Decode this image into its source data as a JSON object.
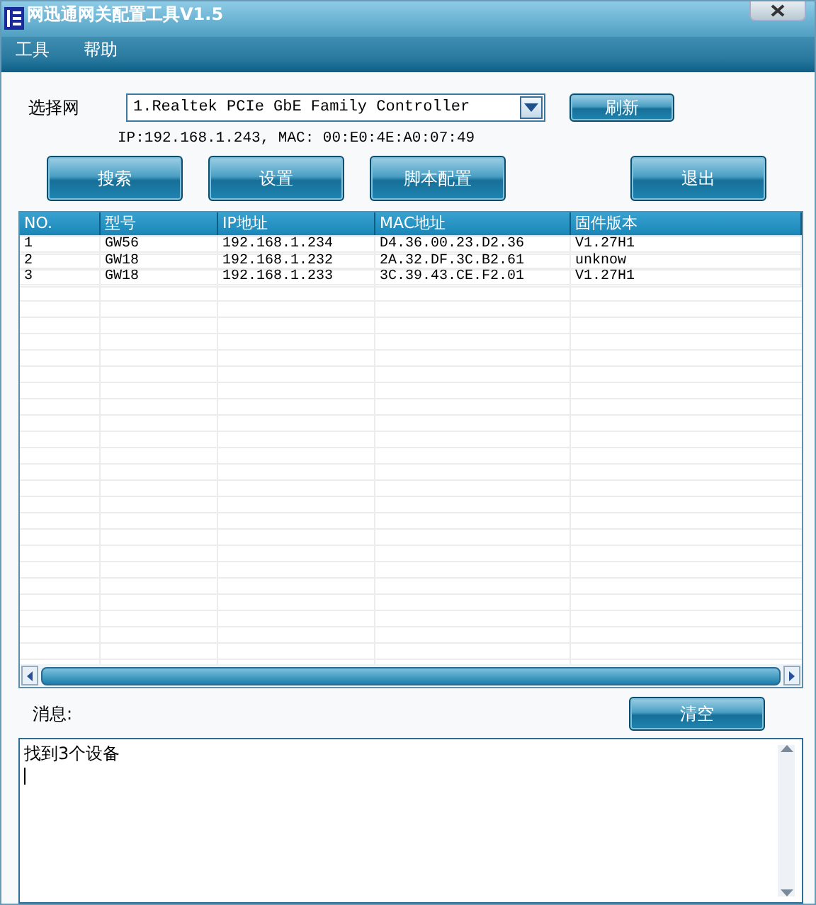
{
  "window": {
    "title": "网迅通网关配置工具V1.5"
  },
  "menu": [
    "工具",
    "帮助"
  ],
  "network": {
    "label": "选择网",
    "value": "1.Realtek PCIe GbE Family Controller",
    "refresh": "刷新",
    "info": "IP:192.168.1.243, MAC: 00:E0:4E:A0:07:49"
  },
  "actions": [
    "搜索",
    "设置",
    "脚本配置",
    "退出"
  ],
  "table": {
    "columns": [
      "NO.",
      "型号",
      "IP地址",
      "MAC地址",
      "固件版本"
    ],
    "rows": [
      [
        "1",
        "GW56",
        "192.168.1.234",
        "D4.36.00.23.D2.36",
        "V1.27H1"
      ],
      [
        "2",
        "GW18",
        "192.168.1.232",
        "2A.32.DF.3C.B2.61",
        "unknow"
      ],
      [
        "3",
        "GW18",
        "192.168.1.233",
        "3C.39.43.CE.F2.01",
        "V1.27H1"
      ]
    ]
  },
  "messages": {
    "label": "消息:",
    "clear": "清空",
    "text": "找到3个设备"
  }
}
